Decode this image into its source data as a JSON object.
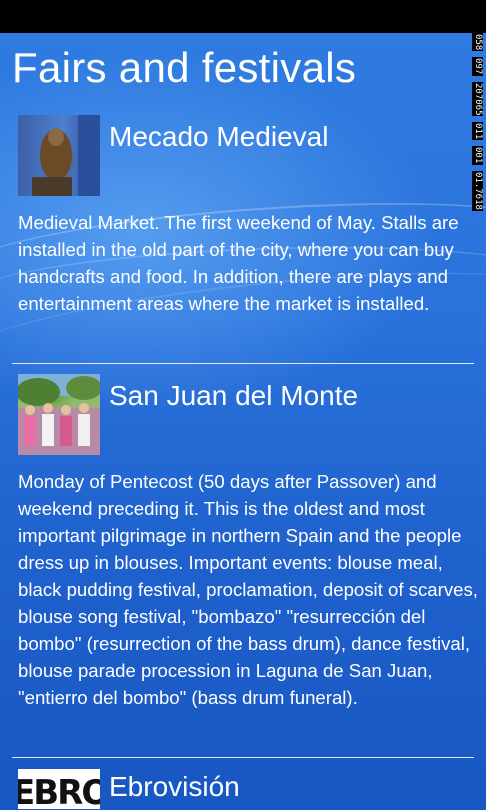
{
  "page": {
    "title": "Fairs and festivals"
  },
  "items": [
    {
      "name": "Mecado Medieval",
      "description": "Medieval Market. The first weekend of May. Stalls are installed in the old part of the city, where you can buy handcrafts and food. In addition, there are plays and entertainment areas where the market is installed.",
      "thumbnail": "falcon-photo"
    },
    {
      "name": "San Juan del Monte",
      "description": "Monday of Pentecost (50 days after Passover) and weekend preceding it. This is the oldest and most important pilgrimage in northern Spain and the people dress up in blouses. Important events: blouse meal, black pudding festival, proclamation, deposit of scarves, blouse song festival, \"bombazo\" \"resurrección del bombo\" (resurrection of the bass drum), dance festival, blouse parade procession in Laguna de San Juan, \"entierro del bombo\" (bass drum funeral).",
      "thumbnail": "crowd-photo"
    },
    {
      "name": "Ebrovisión",
      "thumbnail": "ebrovision-logo",
      "logo_text": "EBRO"
    }
  ],
  "debug_counters": [
    "058",
    "097",
    "207065",
    "011",
    "001",
    "01.7618"
  ],
  "colors": {
    "background": "#2a72dc",
    "status_bar": "#000000",
    "text": "#ffffff"
  }
}
